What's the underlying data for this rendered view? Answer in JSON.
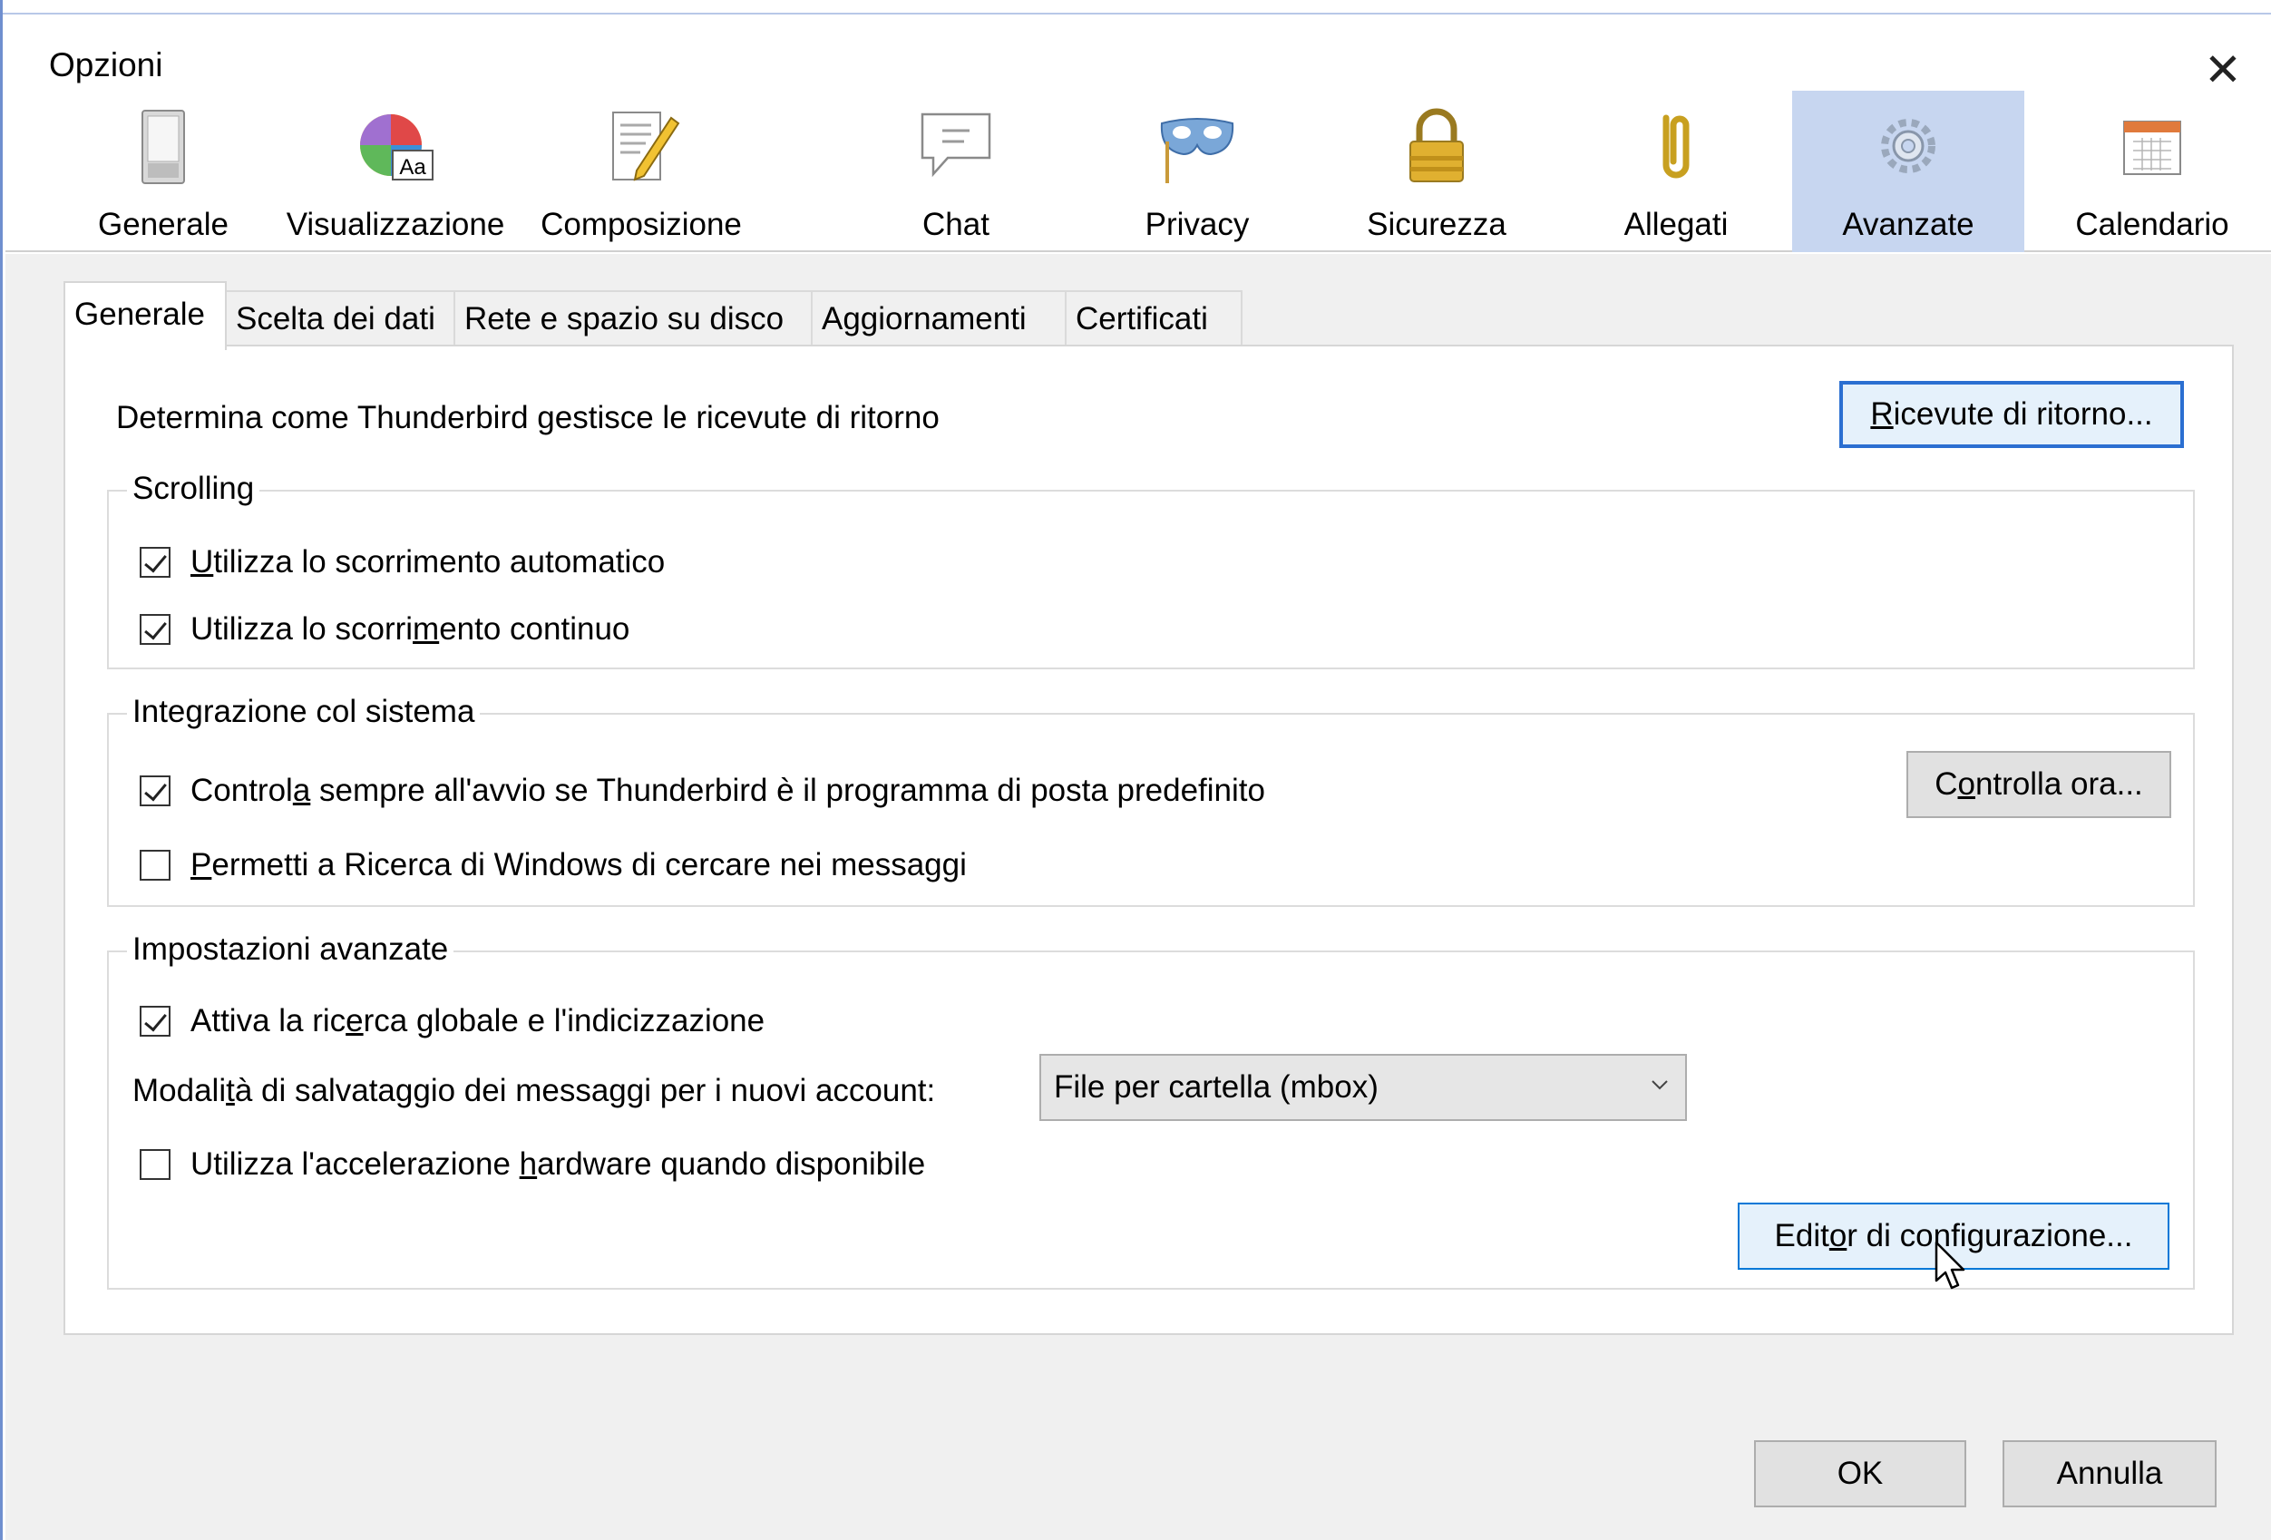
{
  "window": {
    "title": "Opzioni",
    "close_symbol": "✕"
  },
  "panes": [
    {
      "label": "Generale",
      "icon": "switch-icon"
    },
    {
      "label": "Visualizzazione",
      "icon": "font-palette-icon"
    },
    {
      "label": "Composizione",
      "icon": "compose-pencil-icon"
    },
    {
      "label": "Chat",
      "icon": "chat-bubble-icon"
    },
    {
      "label": "Privacy",
      "icon": "mask-icon"
    },
    {
      "label": "Sicurezza",
      "icon": "padlock-icon"
    },
    {
      "label": "Allegati",
      "icon": "paperclip-icon"
    },
    {
      "label": "Avanzate",
      "icon": "gears-icon",
      "selected": true
    },
    {
      "label": "Calendario",
      "icon": "calendar-icon"
    }
  ],
  "icon_text": {
    "font_aa": "Aa"
  },
  "tabs": [
    {
      "label": "Generale",
      "selected": true
    },
    {
      "label": "Scelta dei dati"
    },
    {
      "label": "Rete e spazio su disco"
    },
    {
      "label": "Aggiornamenti"
    },
    {
      "label": "Certificati"
    }
  ],
  "receipts": {
    "description": "Determina come Thunderbird gestisce le ricevute di ritorno",
    "button": {
      "pre": "",
      "u": "R",
      "post": "icevute di ritorno..."
    }
  },
  "scrolling": {
    "caption": "Scrolling",
    "auto": {
      "pre": "",
      "u": "U",
      "post": "tilizza lo scorrimento automatico",
      "checked": true
    },
    "smooth": {
      "pre": "Utilizza lo scorri",
      "u": "m",
      "post": "ento continuo",
      "checked": true
    }
  },
  "system": {
    "caption": "Integrazione col sistema",
    "default_check": {
      "pre": "Control",
      "u": "l",
      "u2": "a",
      "post": " sempre all'avvio se Thunderbird è il programma di posta predefinito",
      "checked": true
    },
    "check_now": {
      "pre": "C",
      "u": "o",
      "post": "ntrolla ora..."
    },
    "search": {
      "pre": "",
      "u": "P",
      "post": "ermetti a Ricerca di Windows di cercare nei messaggi",
      "checked": false
    }
  },
  "advanced": {
    "caption": "Impostazioni avanzate",
    "global_search": {
      "pre": "Attiva la ric",
      "u": "e",
      "post": "rca globale e l'indicizzazione",
      "checked": true
    },
    "store_label": {
      "pre": "Modali",
      "u": "t",
      "post": "à di salvataggio dei messaggi per i nuovi account:"
    },
    "store_value": "File per cartella (mbox)",
    "hw_accel": {
      "pre": "Utilizza l'accelerazione ",
      "u": "h",
      "post": "ardware quando disponibile",
      "checked": false
    },
    "config_editor": {
      "pre": "Edit",
      "u": "o",
      "post": "r di configurazione..."
    }
  },
  "footer": {
    "ok": "OK",
    "cancel": "Annulla"
  },
  "colors": {
    "selected_pane": "#c7d6f0",
    "window_border": "#6f8fcf",
    "default_button_border": "#2b6fd1"
  }
}
